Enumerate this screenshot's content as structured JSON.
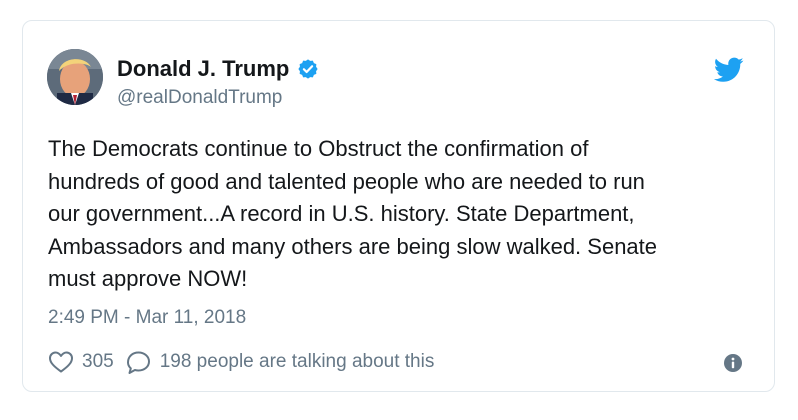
{
  "tweet": {
    "author": {
      "display_name": "Donald J. Trump",
      "handle": "@realDonaldTrump",
      "verified": true
    },
    "text": "The Democrats continue to Obstruct the confirmation of\nhundreds of good and talented people who are needed to run\nour government...A record in U.S. history. State Department,\nAmbassadors and many others are being slow walked. Senate\nmust approve NOW!",
    "timestamp": "2:49 PM - Mar 11, 2018",
    "likes": "305",
    "talking": "198 people are talking about this"
  },
  "icons": {
    "brand": "twitter-bird-icon",
    "verified": "verified-badge-icon",
    "like": "heart-icon",
    "reply": "speech-bubble-icon",
    "info": "info-icon"
  },
  "colors": {
    "brand_blue": "#1da1f2",
    "text_primary": "#14171a",
    "text_secondary": "#657786",
    "border": "#e1e8ed"
  }
}
